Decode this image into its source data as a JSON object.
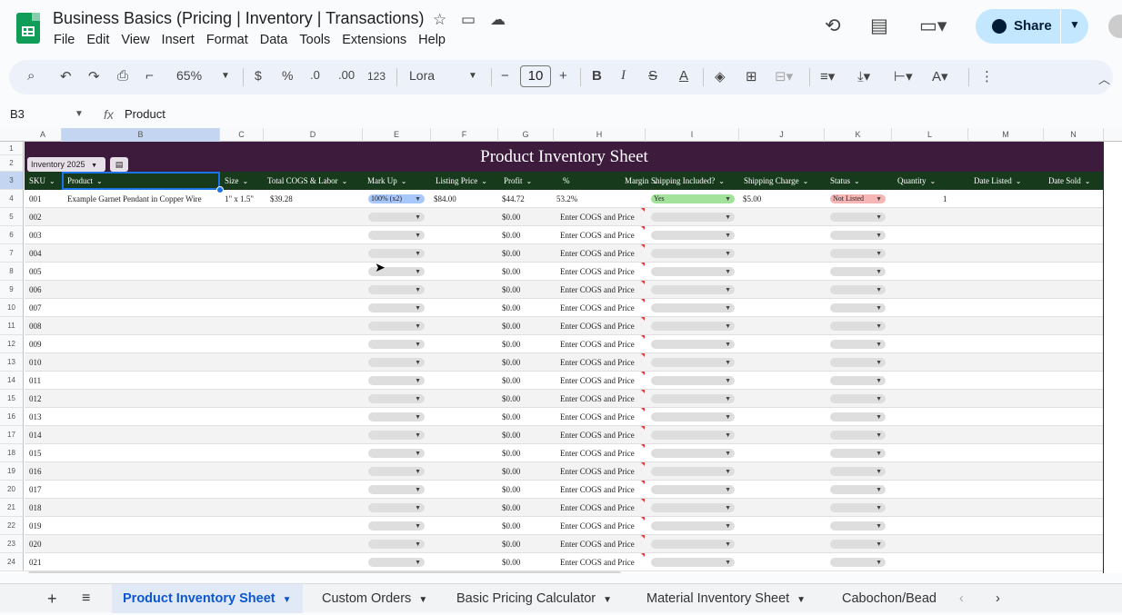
{
  "doc": {
    "title": "Business Basics (Pricing | Inventory | Transactions)",
    "menu": [
      "File",
      "Edit",
      "View",
      "Insert",
      "Format",
      "Data",
      "Tools",
      "Extensions",
      "Help"
    ],
    "share_label": "Share"
  },
  "toolbar": {
    "zoom": "65%",
    "currency": "$",
    "percent": "%",
    "dec_decrease": ".0",
    "dec_increase": ".00",
    "number_format": "123",
    "font": "Lora",
    "font_size": "10"
  },
  "formula_bar": {
    "cell_ref": "B3",
    "content": "Product"
  },
  "grid": {
    "column_letters": [
      "A",
      "B",
      "C",
      "D",
      "E",
      "F",
      "G",
      "H",
      "I",
      "J",
      "K",
      "L",
      "M",
      "N"
    ],
    "sheet_title": "Product Inventory Sheet",
    "table_name": "Inventory 2025",
    "headers": [
      "SKU",
      "Product",
      "Size",
      "Total COGS & Labor",
      "Mark Up",
      "Listing Price",
      "Profit",
      "%",
      "Margin",
      "Shipping Included?",
      "Shipping Charge",
      "Status",
      "Quantity",
      "Date Listed",
      "Date Sold"
    ],
    "first_row": {
      "sku": "001",
      "product": "Example Garnet Pendant in Copper Wire",
      "size": "1\" x 1.5\"",
      "cogs": "$39.28",
      "markup": "100% (x2)",
      "listing_price": "$84.00",
      "profit": "$44.72",
      "margin": "53.2%",
      "shipping_included": "Yes",
      "shipping_charge": "$5.00",
      "status": "Not Listed",
      "quantity": "1"
    },
    "empty_profit": "$0.00",
    "empty_margin_note": "Enter COGS and Price",
    "skus": [
      "002",
      "003",
      "004",
      "005",
      "006",
      "007",
      "008",
      "009",
      "010",
      "011",
      "012",
      "013",
      "014",
      "015",
      "016",
      "017",
      "018",
      "019",
      "020",
      "021"
    ],
    "row_numbers": [
      "1",
      "2",
      "3",
      "4",
      "5",
      "6",
      "7",
      "8",
      "9",
      "10",
      "11",
      "12",
      "13",
      "14",
      "15",
      "16",
      "17",
      "18",
      "19",
      "20",
      "21",
      "22",
      "23",
      "24"
    ]
  },
  "tabs": [
    "Product Inventory Sheet",
    "Custom Orders",
    "Basic Pricing Calculator",
    "Material Inventory Sheet",
    "Cabochon/Bead"
  ],
  "colors": {
    "banner": "#3d1b3d",
    "header_row": "#173a1d",
    "active_tab": "#0b57d0",
    "share_button": "#c2e7ff"
  }
}
